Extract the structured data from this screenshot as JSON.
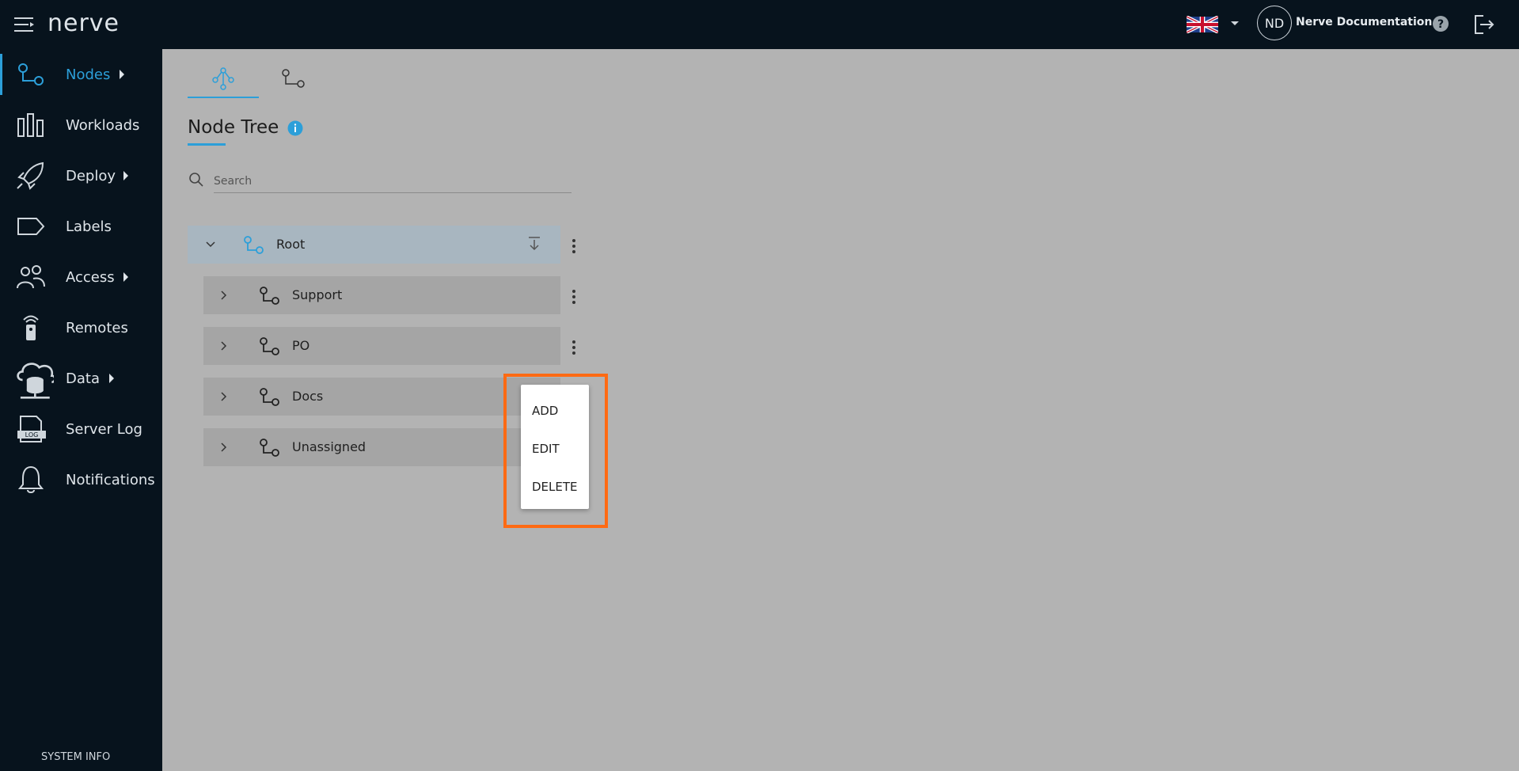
{
  "header": {
    "logo": "nerve",
    "user_initials": "ND",
    "user_name": "Nerve Documentation",
    "language": "English (UK)"
  },
  "sidebar": {
    "items": [
      {
        "label": "Nodes",
        "icon": "nodes-icon",
        "active": true
      },
      {
        "label": "Workloads",
        "icon": "workloads-icon"
      },
      {
        "label": "Deploy",
        "icon": "rocket-icon"
      },
      {
        "label": "Labels",
        "icon": "label-icon"
      },
      {
        "label": "Access",
        "icon": "users-icon"
      },
      {
        "label": "Remotes",
        "icon": "remote-icon"
      },
      {
        "label": "Data",
        "icon": "cloud-database-icon"
      },
      {
        "label": "Server Log",
        "icon": "log-icon"
      },
      {
        "label": "Notifications",
        "icon": "bell-icon"
      }
    ],
    "system_info": "SYSTEM INFO"
  },
  "main": {
    "tabs": [
      {
        "name": "tree-view",
        "icon": "node-tree-icon",
        "active": true
      },
      {
        "name": "list-view",
        "icon": "node-icon"
      }
    ],
    "title": "Node Tree",
    "search_placeholder": "Search",
    "tree": {
      "root": {
        "label": "Root"
      },
      "children": [
        {
          "label": "Support"
        },
        {
          "label": "PO"
        },
        {
          "label": "Docs"
        },
        {
          "label": "Unassigned"
        }
      ]
    },
    "context_menu": {
      "items": [
        "ADD",
        "EDIT",
        "DELETE"
      ]
    }
  },
  "colors": {
    "accent": "#2c9fd9",
    "highlight": "#ff6a13",
    "sidebar_bg": "#07131d"
  }
}
